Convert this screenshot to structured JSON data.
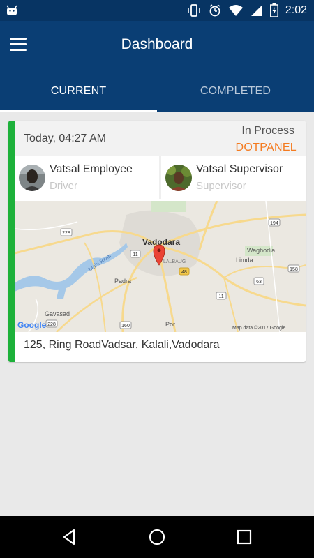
{
  "status_bar": {
    "time": "2:02",
    "icons": [
      "android-icon",
      "vibrate-icon",
      "alarm-icon",
      "wifi-icon",
      "signal-icon",
      "battery-charging-icon"
    ]
  },
  "app_bar": {
    "title": "Dashboard",
    "menu_icon": "hamburger-menu-icon"
  },
  "tabs": [
    {
      "label": "CURRENT",
      "active": true
    },
    {
      "label": "COMPLETED",
      "active": false
    }
  ],
  "job_card": {
    "datetime": "Today, 04:27 AM",
    "status": "In Process",
    "company": "DOTPANEL",
    "accent_color": "#1db13a",
    "company_color": "#f47b20",
    "employee": {
      "name": "Vatsal Employee",
      "role": "Driver"
    },
    "supervisor": {
      "name": "Vatsal Supervisor",
      "role": "Supervisor"
    },
    "map": {
      "city": "Vadodara",
      "places": [
        "LALBAUG",
        "Waghodia",
        "Limda",
        "Padra",
        "Gavasad",
        "Por"
      ],
      "river": "Mahi River",
      "road_shields": [
        "228",
        "194",
        "48",
        "158",
        "63",
        "11",
        "11",
        "160",
        "228"
      ],
      "logo": "Google",
      "attribution": "Map data ©2017 Google"
    },
    "address": "125, Ring RoadVadsar, Kalali,Vadodara"
  },
  "nav_bar": {
    "buttons": [
      "back-icon",
      "home-icon",
      "recents-icon"
    ]
  }
}
